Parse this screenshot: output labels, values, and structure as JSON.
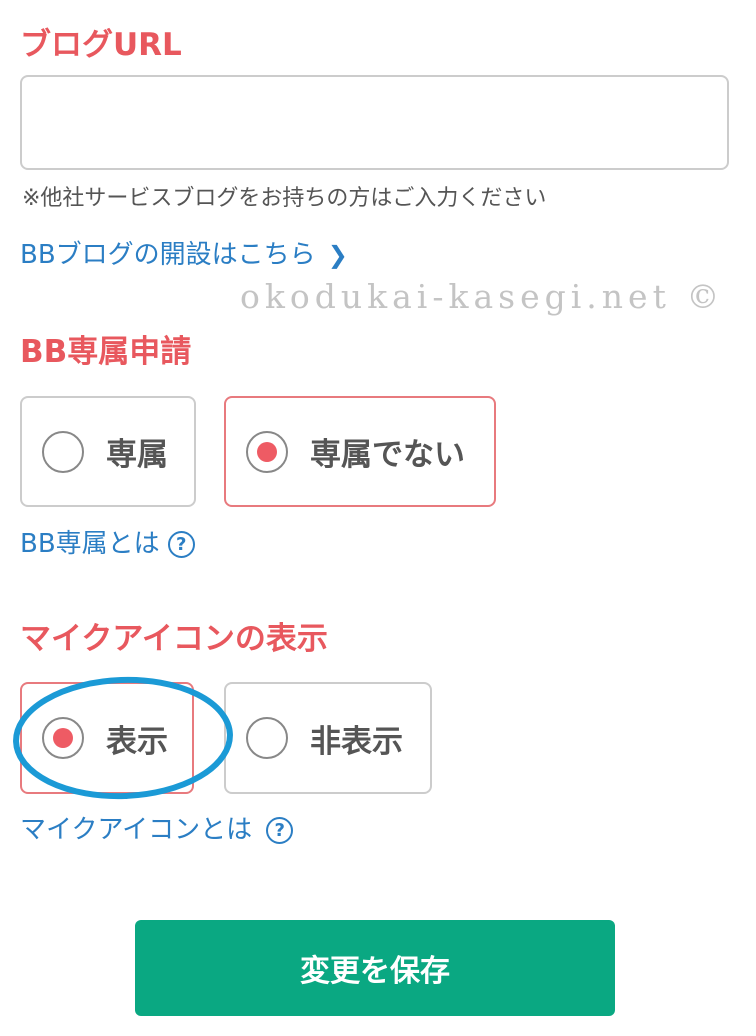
{
  "blog_url": {
    "title": "ブログURL",
    "value": "",
    "placeholder": "",
    "note": "※他社サービスブログをお持ちの方はご入力ください",
    "link_label": "BBブログの開設はこちら",
    "link_icon": "chevron-right-icon"
  },
  "watermark": "okodukai-kasegi.net ©",
  "exclusive": {
    "title": "BB専属申請",
    "options": [
      {
        "label": "専属",
        "selected": false
      },
      {
        "label": "専属でない",
        "selected": true
      }
    ],
    "help_label": "BB専属とは",
    "help_icon": "?"
  },
  "mic_icon": {
    "title": "マイクアイコンの表示",
    "options": [
      {
        "label": "表示",
        "selected": true
      },
      {
        "label": "非表示",
        "selected": false
      }
    ],
    "help_label": "マイクアイコンとは",
    "help_icon": "?"
  },
  "save_label": "変更を保存",
  "colors": {
    "accent": "#e8585e",
    "link": "#2b7ec4",
    "button": "#0aa882",
    "selected_border": "#e87a7e",
    "annotation": "#1b9ad6"
  }
}
